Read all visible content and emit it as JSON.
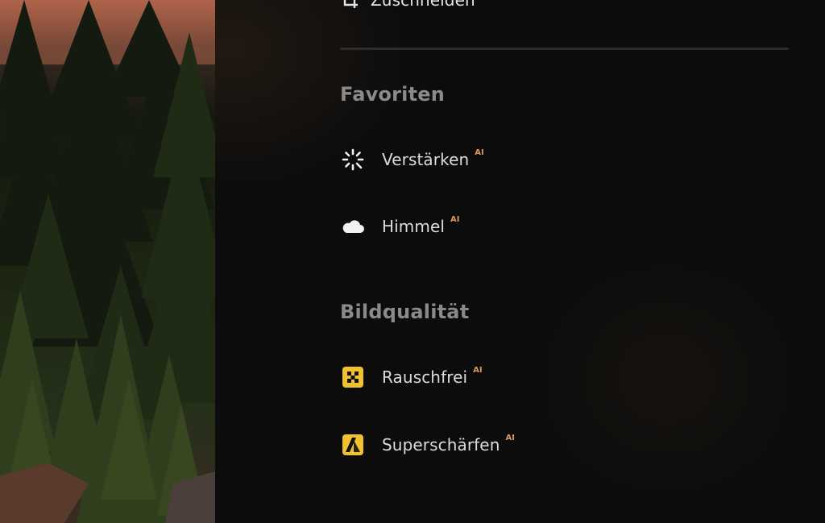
{
  "photo": {
    "description_icon": "forest-photo-preview"
  },
  "panel": {
    "crop": {
      "label": "Zuschneiden",
      "icon": "crop-icon"
    },
    "sections": [
      {
        "title": "Favoriten",
        "items": [
          {
            "label": "Verstärken",
            "badge": "AI",
            "icon": "sparkle-enhance-icon"
          },
          {
            "label": "Himmel",
            "badge": "AI",
            "icon": "cloud-icon"
          }
        ]
      },
      {
        "title": "Bildqualität",
        "items": [
          {
            "label": "Rauschfrei",
            "badge": "AI",
            "icon": "denoise-icon"
          },
          {
            "label": "Superschärfen",
            "badge": "AI",
            "icon": "supersharpen-icon"
          }
        ]
      }
    ]
  },
  "colors": {
    "badge": "#d79a5c",
    "accent_yellow": "#f2c12e",
    "section_title": "#8a8a8a",
    "panel_bg": "#0c0c0c"
  }
}
